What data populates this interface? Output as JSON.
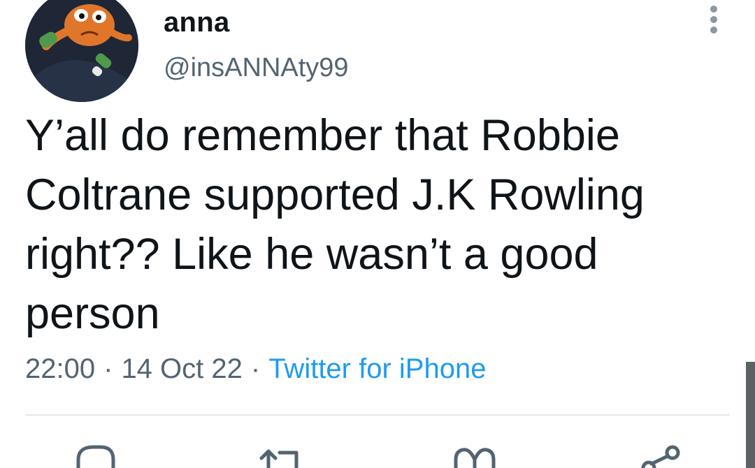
{
  "author": {
    "name": "anna",
    "handle": "@insANNAty99",
    "avatar_icon": "cartoon-character-avatar"
  },
  "tweet": {
    "text": "Y’all do remember that Robbie\nColtrane supported J.K Rowling\nright?? Like he wasn’t a good\nperson",
    "time": "22:00",
    "date": "14 Oct 22",
    "separator": "·",
    "source": "Twitter for iPhone"
  },
  "actions": [
    {
      "icon": "reply-icon"
    },
    {
      "icon": "retweet-icon"
    },
    {
      "icon": "like-icon"
    },
    {
      "icon": "share-icon"
    }
  ],
  "colors": {
    "text": "#0f1419",
    "secondary": "#536471",
    "accent": "#1d9bf0",
    "divider": "#e1e8ed"
  }
}
